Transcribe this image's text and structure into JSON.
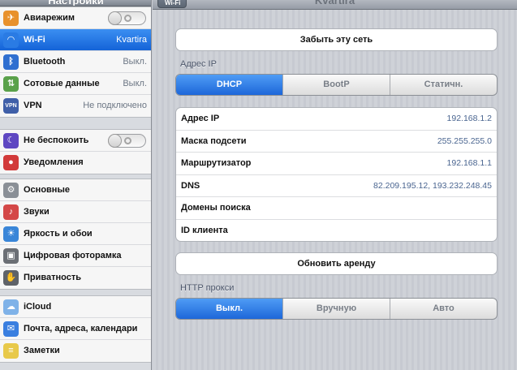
{
  "sidebar": {
    "title": "Настройки",
    "group1": [
      {
        "label": "Авиарежим",
        "icon": "airplane-icon",
        "switch": true
      },
      {
        "label": "Wi-Fi",
        "value": "Kvartira",
        "icon": "wifi-icon",
        "selected": true
      },
      {
        "label": "Bluetooth",
        "value": "Выкл.",
        "icon": "bluetooth-icon"
      },
      {
        "label": "Сотовые данные",
        "value": "Выкл.",
        "icon": "cellular-icon"
      },
      {
        "label": "VPN",
        "value": "Не подключено",
        "icon": "vpn-icon",
        "icon_text": "VPN"
      }
    ],
    "group2": [
      {
        "label": "Не беспокоить",
        "icon": "moon-icon",
        "switch": true
      },
      {
        "label": "Уведомления",
        "icon": "notifications-icon"
      }
    ],
    "group3": [
      {
        "label": "Основные",
        "icon": "gear-icon"
      },
      {
        "label": "Звуки",
        "icon": "speaker-icon"
      },
      {
        "label": "Яркость и обои",
        "icon": "brightness-icon"
      },
      {
        "label": "Цифровая фоторамка",
        "icon": "photo-frame-icon"
      },
      {
        "label": "Приватность",
        "icon": "hand-icon"
      }
    ],
    "group4": [
      {
        "label": "iCloud",
        "icon": "cloud-icon"
      },
      {
        "label": "Почта, адреса, календари",
        "icon": "mail-icon"
      },
      {
        "label": "Заметки",
        "icon": "notes-icon"
      }
    ]
  },
  "detail": {
    "back_label": "Wi-Fi",
    "title": "Kvartira",
    "forget_label": "Забыть эту сеть",
    "ip_section": "Адрес IP",
    "ip_modes": [
      "DHCP",
      "BootP",
      "Статичн."
    ],
    "ip_mode_selected": 0,
    "info_rows": [
      {
        "key": "Адрес IP",
        "value": "192.168.1.2"
      },
      {
        "key": "Маска подсети",
        "value": "255.255.255.0"
      },
      {
        "key": "Маршрутизатор",
        "value": "192.168.1.1"
      },
      {
        "key": "DNS",
        "value": "82.209.195.12, 193.232.248.45"
      },
      {
        "key": "Домены поиска",
        "value": ""
      },
      {
        "key": "ID клиента",
        "value": ""
      }
    ],
    "renew_label": "Обновить аренду",
    "proxy_section": "HTTP прокси",
    "proxy_modes": [
      "Выкл.",
      "Вручную",
      "Авто"
    ],
    "proxy_mode_selected": 0
  },
  "colors": {
    "accent": "#1e6fdf",
    "value_text": "#4a6590"
  }
}
